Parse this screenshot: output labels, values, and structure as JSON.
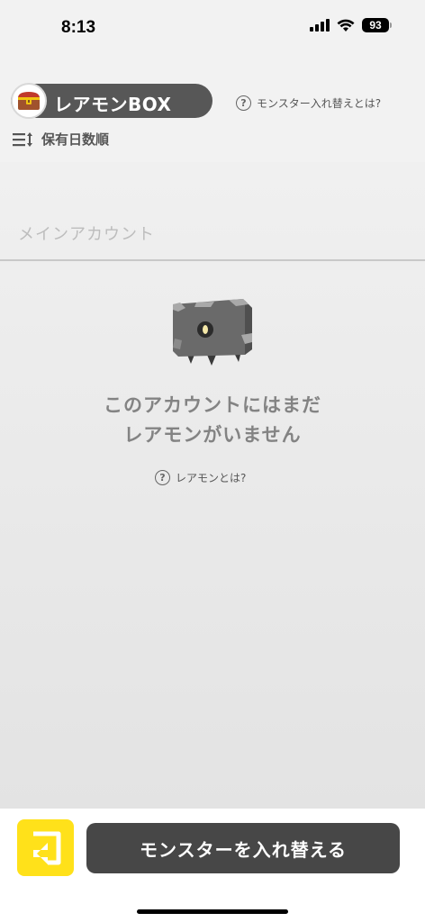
{
  "status_bar": {
    "time": "8:13",
    "battery": "93"
  },
  "header": {
    "title": "レアモンBOX",
    "help_label": "モンスター入れ替えとは?",
    "sort_label": "保有日数順"
  },
  "main": {
    "account_label": "メインアカウント",
    "empty_message_line1": "このアカウントにはまだ",
    "empty_message_line2": "レアモンがいません",
    "empty_help_label": "レアモンとは?"
  },
  "bottom": {
    "swap_button_label": "モンスターを入れ替える"
  },
  "colors": {
    "accent_yellow": "#ffe11a",
    "dark_button": "#474747",
    "title_pill": "#575757"
  }
}
